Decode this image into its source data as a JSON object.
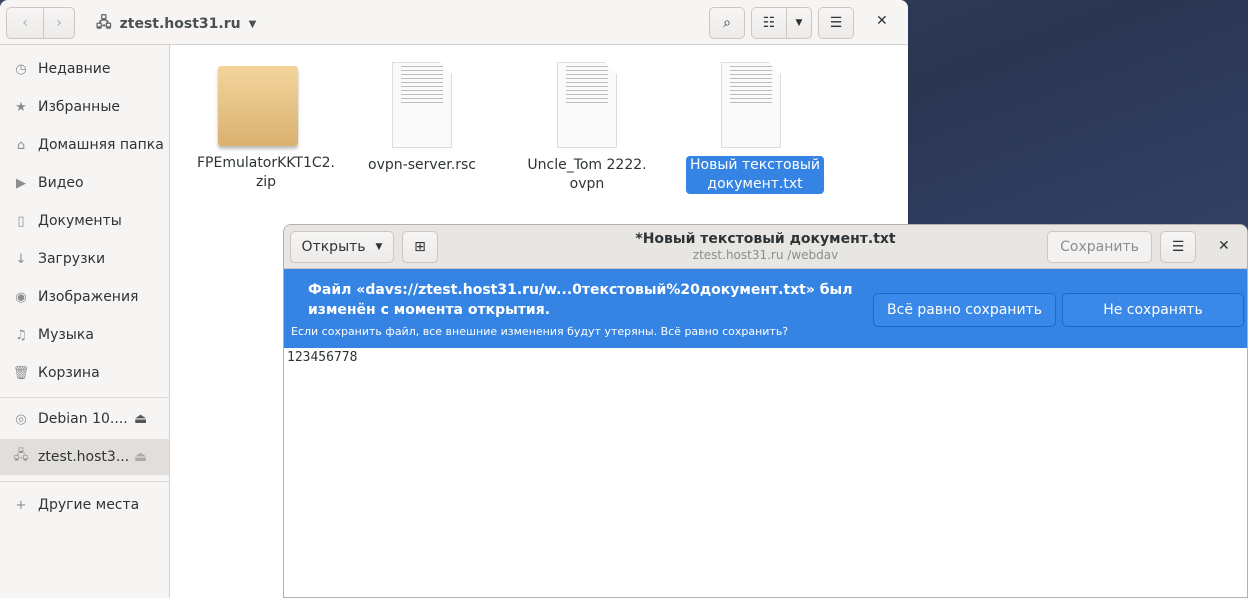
{
  "file_manager": {
    "location": "ztest.host31.ru",
    "sidebar": [
      {
        "label": "Недавние",
        "icon": "clock-icon"
      },
      {
        "label": "Избранные",
        "icon": "star-icon"
      },
      {
        "label": "Домашняя папка",
        "icon": "home-icon"
      },
      {
        "label": "Видео",
        "icon": "video-icon"
      },
      {
        "label": "Документы",
        "icon": "document-icon"
      },
      {
        "label": "Загрузки",
        "icon": "download-icon"
      },
      {
        "label": "Изображения",
        "icon": "camera-icon"
      },
      {
        "label": "Музыка",
        "icon": "music-icon"
      },
      {
        "label": "Корзина",
        "icon": "trash-icon"
      }
    ],
    "devices": [
      {
        "label": "Debian 10....",
        "icon": "disc-icon"
      },
      {
        "label": "ztest.host3...",
        "icon": "network-icon"
      }
    ],
    "other": "Другие места",
    "files": [
      {
        "name": "FPEmulatorKKT1C2.\nzip",
        "type": "archive"
      },
      {
        "name": "ovpn-server.rsc",
        "type": "text"
      },
      {
        "name": "Uncle_Tom 2222.\novpn",
        "type": "text"
      },
      {
        "name": "Новый текстовый\nдокумент.txt",
        "type": "text",
        "selected": true
      }
    ]
  },
  "editor": {
    "open_label": "Открыть",
    "title": "*Новый текстовый документ.txt",
    "subtitle": "ztest.host31.ru /webdav",
    "save_label": "Сохранить",
    "info_main": "Файл «davs://ztest.host31.ru/w...0текстовый%20документ.txt» был изменён с момента открытия.",
    "info_sub": "Если сохранить файл, все внешние изменения будут утеряны. Всё равно сохранить?",
    "save_anyway": "Всё равно сохранить",
    "dont_save": "Не сохранять",
    "content": "123456778"
  }
}
